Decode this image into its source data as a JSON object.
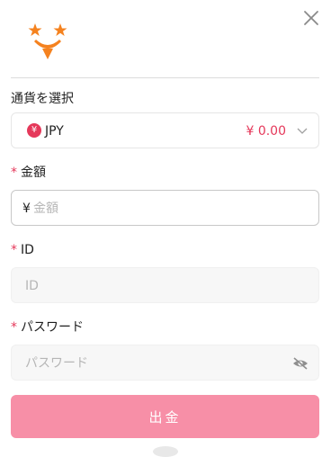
{
  "header": {
    "logo": "star-smile-logo",
    "close_icon": "close-icon"
  },
  "currency": {
    "label": "通貨を選択",
    "coin_symbol": "¥",
    "code": "JPY",
    "balance": "¥ 0.00"
  },
  "amount": {
    "required_mark": "*",
    "label": "金額",
    "prefix": "¥",
    "placeholder": "金額"
  },
  "id_field": {
    "required_mark": "*",
    "label": "ID",
    "placeholder": "ID"
  },
  "password": {
    "required_mark": "*",
    "label": "パスワード",
    "placeholder": "パスワード"
  },
  "submit": {
    "label": "出金"
  },
  "colors": {
    "accent": "#e5385a",
    "logo_orange": "#f5821f",
    "button_pink": "#f78fa7"
  }
}
